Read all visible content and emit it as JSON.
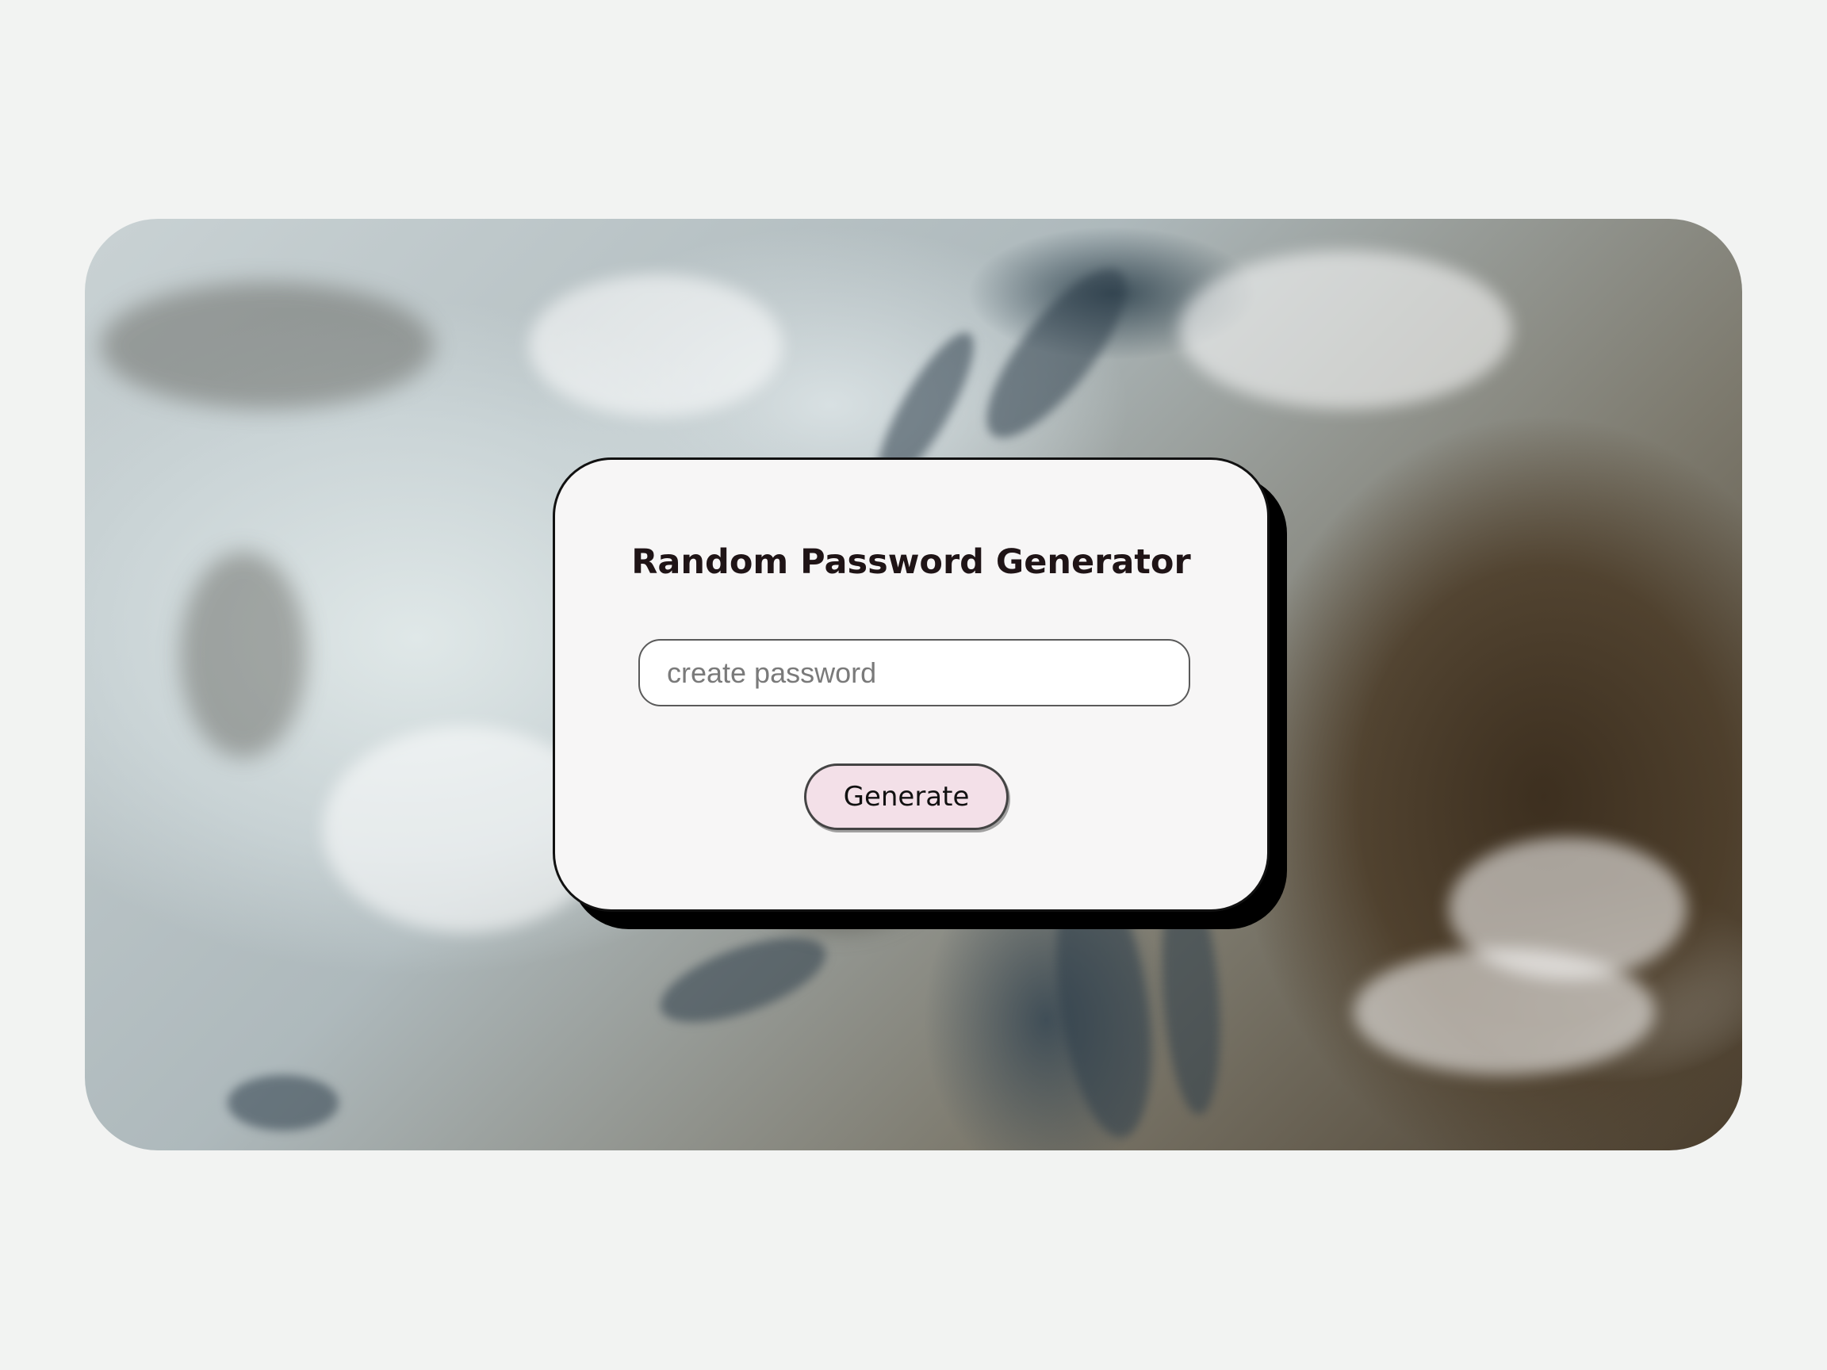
{
  "app": {
    "title": "Random Password Generator"
  },
  "password_field": {
    "value": "",
    "placeholder": "create password"
  },
  "generate_button": {
    "label": "Generate"
  },
  "colors": {
    "page_background": "#f2f3f2",
    "card_background": "#f7f6f6",
    "card_shadow": "#000000",
    "button_background": "#f3e0e8",
    "title_text": "#1f1416"
  }
}
